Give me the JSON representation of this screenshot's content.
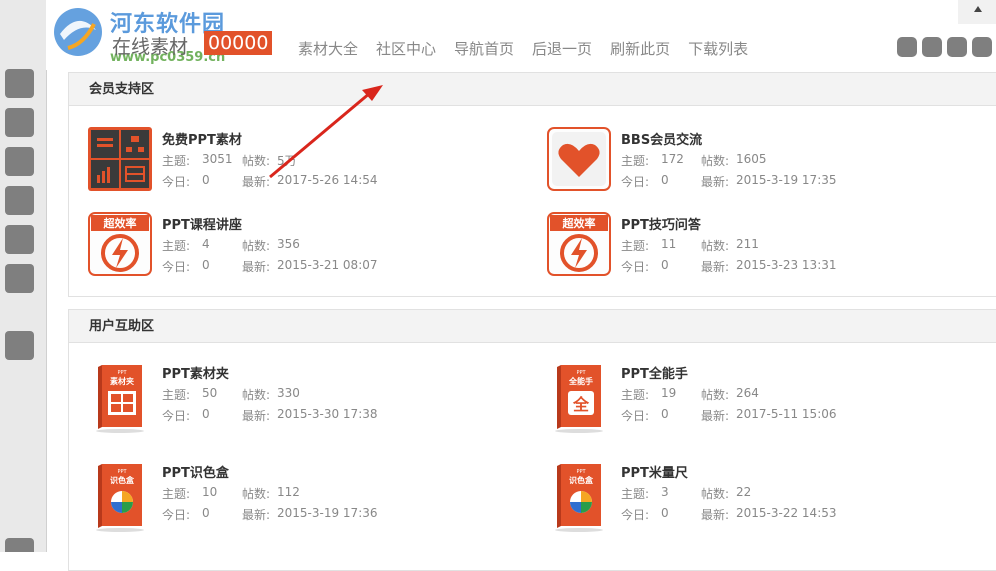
{
  "watermark": {
    "title": "河东软件园",
    "url": "www.pc0359.cn"
  },
  "header": {
    "online_label": "在线素材",
    "online_count": "00000",
    "nav": [
      "素材大全",
      "社区中心",
      "导航首页",
      "后退一页",
      "刷新此页",
      "下载列表"
    ]
  },
  "labels": {
    "topics": "主题:",
    "posts": "帖数:",
    "today": "今日:",
    "latest": "最新:"
  },
  "sections": [
    {
      "title": "会员支持区",
      "forums": [
        {
          "name": "免费PPT素材",
          "icon": "ppt-material-grid-icon",
          "topics": "3051",
          "posts": "5万",
          "today": "0",
          "latest": "2017-5-26 14:54"
        },
        {
          "name": "BBS会员交流",
          "icon": "heart-icon",
          "topics": "172",
          "posts": "1605",
          "today": "0",
          "latest": "2015-3-19 17:35"
        },
        {
          "name": "PPT课程讲座",
          "icon": "efficiency-lightning-icon",
          "icon_text": "超效率",
          "topics": "4",
          "posts": "356",
          "today": "0",
          "latest": "2015-3-21 08:07"
        },
        {
          "name": "PPT技巧问答",
          "icon": "efficiency-lightning-icon",
          "icon_text": "超效率",
          "topics": "11",
          "posts": "211",
          "today": "0",
          "latest": "2015-3-23 13:31"
        }
      ]
    },
    {
      "title": "用户互助区",
      "forums": [
        {
          "name": "PPT素材夹",
          "icon": "product-box-icon",
          "icon_text": "素材夹",
          "topics": "50",
          "posts": "330",
          "today": "0",
          "latest": "2015-3-30 17:38"
        },
        {
          "name": "PPT全能手",
          "icon": "product-box-icon",
          "icon_text": "全能手",
          "topics": "19",
          "posts": "264",
          "today": "0",
          "latest": "2017-5-11 15:06"
        },
        {
          "name": "PPT识色盒",
          "icon": "product-box-icon",
          "icon_text": "识色盒",
          "topics": "10",
          "posts": "112",
          "today": "0",
          "latest": "2015-3-19 17:36"
        },
        {
          "name": "PPT米量尺",
          "icon": "product-box-icon",
          "icon_text": "识色盒",
          "topics": "3",
          "posts": "22",
          "today": "0",
          "latest": "2015-3-22 14:53"
        }
      ]
    }
  ],
  "colors": {
    "accent": "#e2522a",
    "icon_dark": "#3a3a3a",
    "header_bg": "#f3f3f3",
    "rail": "#7f7f7f",
    "arrow": "#d9261c"
  }
}
